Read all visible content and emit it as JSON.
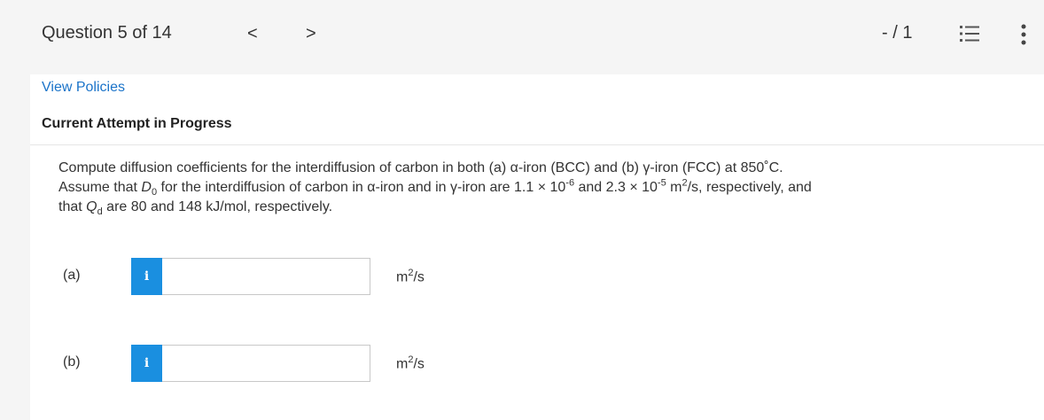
{
  "header": {
    "question_label": "Question 5 of 14",
    "prev_glyph": "<",
    "next_glyph": ">",
    "score": "- / 1",
    "icons": [
      "list-icon",
      "more-vertical-icon"
    ]
  },
  "links": {
    "view_policies": "View Policies"
  },
  "attempt_status": "Current Attempt in Progress",
  "question": {
    "line1": "Compute diffusion coefficients for the interdiffusion of carbon in both (a) α-iron (BCC) and (b) γ-iron (FCC) at 850˚C.",
    "l2_a": "Assume that ",
    "l2_D": "D",
    "l2_sub0": "0",
    "l2_b": " for the interdiffusion of carbon in α-iron and in γ-iron are 1.1 × 10",
    "l2_exp1": "-6",
    "l2_c": " and 2.3 × 10",
    "l2_exp2": "-5",
    "l2_d": " m",
    "l2_exp3": "2",
    "l2_e": "/s, respectively, and",
    "l3_a": "that ",
    "l3_Q": "Q",
    "l3_subd": "d",
    "l3_b": " are 80 and 148 kJ/mol, respectively."
  },
  "answers": [
    {
      "label": "(a)",
      "info": "i",
      "value": "",
      "unit_base": "m",
      "unit_exp": "2",
      "unit_tail": "/s"
    },
    {
      "label": "(b)",
      "info": "i",
      "value": "",
      "unit_base": "m",
      "unit_exp": "2",
      "unit_tail": "/s"
    }
  ]
}
